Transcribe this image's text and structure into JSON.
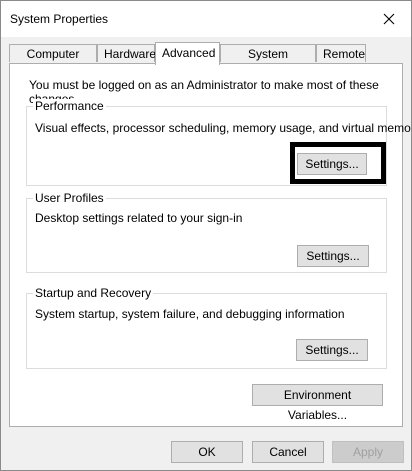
{
  "window": {
    "title": "System Properties"
  },
  "tabs": [
    {
      "label": "Computer Name"
    },
    {
      "label": "Hardware"
    },
    {
      "label": "Advanced"
    },
    {
      "label": "System Protection"
    },
    {
      "label": "Remote"
    }
  ],
  "active_tab": "Advanced",
  "admin_note": "You must be logged on as an Administrator to make most of these changes.",
  "groups": {
    "performance": {
      "title": "Performance",
      "description": "Visual effects, processor scheduling, memory usage, and virtual memory",
      "button": "Settings..."
    },
    "user_profiles": {
      "title": "User Profiles",
      "description": "Desktop settings related to your sign-in",
      "button": "Settings..."
    },
    "startup_recovery": {
      "title": "Startup and Recovery",
      "description": "System startup, system failure, and debugging information",
      "button": "Settings..."
    }
  },
  "env_button": "Environment Variables...",
  "dialog_buttons": {
    "ok": "OK",
    "cancel": "Cancel",
    "apply": "Apply"
  }
}
